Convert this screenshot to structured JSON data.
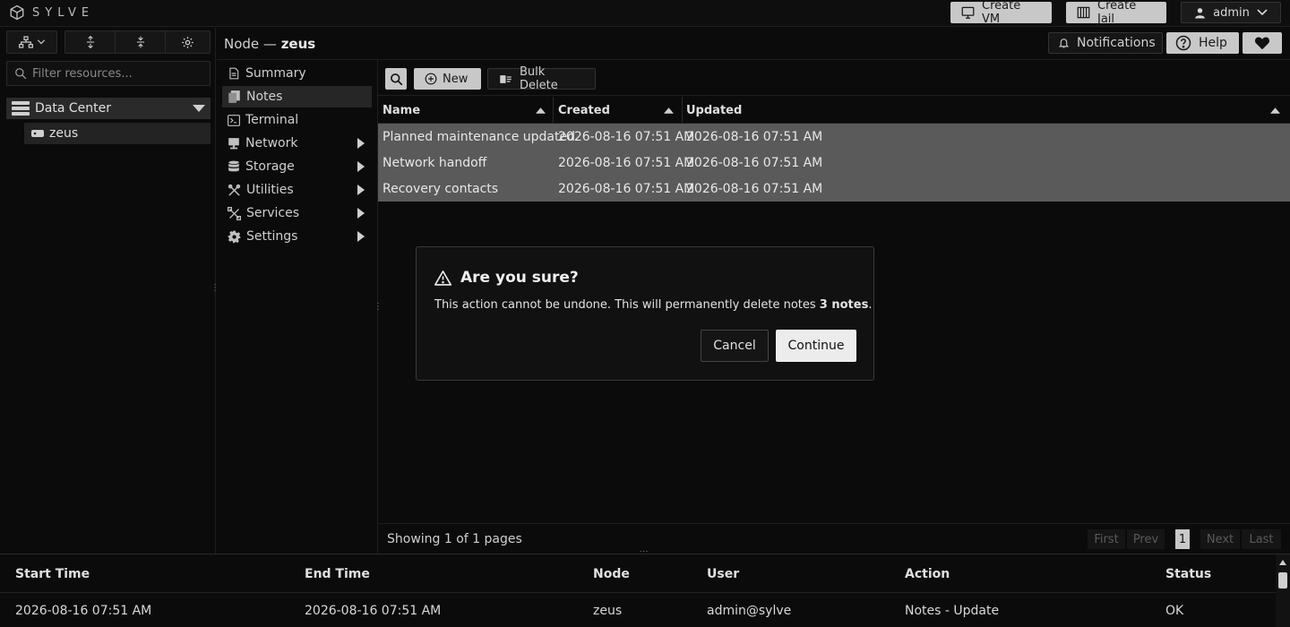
{
  "app": {
    "logo_text": "SYLVE"
  },
  "topbar": {
    "create_vm": "Create VM",
    "create_jail": "Create Jail",
    "user": "admin"
  },
  "sidebar": {
    "filter_placeholder": "Filter resources...",
    "tree": {
      "datacenter": "Data Center",
      "node": "zeus"
    }
  },
  "node_header": {
    "prefix": "Node — ",
    "name": "zeus",
    "notifications": "Notifications",
    "help": "Help"
  },
  "node_menu": [
    {
      "label": "Summary",
      "icon": "summary-icon",
      "active": false,
      "submenu": false
    },
    {
      "label": "Notes",
      "icon": "notes-icon",
      "active": true,
      "submenu": false
    },
    {
      "label": "Terminal",
      "icon": "terminal-icon",
      "active": false,
      "submenu": false
    },
    {
      "label": "Network",
      "icon": "network-icon",
      "active": false,
      "submenu": true
    },
    {
      "label": "Storage",
      "icon": "storage-icon",
      "active": false,
      "submenu": true
    },
    {
      "label": "Utilities",
      "icon": "utilities-icon",
      "active": false,
      "submenu": true
    },
    {
      "label": "Services",
      "icon": "services-icon",
      "active": false,
      "submenu": true
    },
    {
      "label": "Settings",
      "icon": "settings-icon",
      "active": false,
      "submenu": true
    }
  ],
  "toolbar": {
    "new": "New",
    "bulk_delete": "Bulk Delete"
  },
  "notes_table": {
    "columns": [
      "Name",
      "Created",
      "Updated"
    ],
    "rows": [
      [
        "Planned maintenance updated",
        "2026-08-16 07:51 AM",
        "2026-08-16 07:51 AM"
      ],
      [
        "Network handoff",
        "2026-08-16 07:51 AM",
        "2026-08-16 07:51 AM"
      ],
      [
        "Recovery contacts",
        "2026-08-16 07:51 AM",
        "2026-08-16 07:51 AM"
      ]
    ]
  },
  "pagination": {
    "showing": "Showing 1 of 1 pages",
    "first": "First",
    "prev": "Prev",
    "current": "1",
    "next": "Next",
    "last": "Last"
  },
  "log": {
    "columns": [
      "Start Time",
      "End Time",
      "Node",
      "User",
      "Action",
      "Status"
    ],
    "rows": [
      [
        "2026-08-16 07:51 AM",
        "2026-08-16 07:51 AM",
        "zeus",
        "admin@sylve",
        "Notes - Update",
        "OK"
      ]
    ]
  },
  "dialog": {
    "title": "Are you sure?",
    "message": "This action cannot be undone. This will permanently delete notes ",
    "count": "3 notes",
    "message_end": ".",
    "cancel": "Cancel",
    "continue": "Continue"
  },
  "colors": {
    "accent_button": "#c8c8c8",
    "selected_rows": "#5a5a5a",
    "background": "#0b0b0b"
  }
}
